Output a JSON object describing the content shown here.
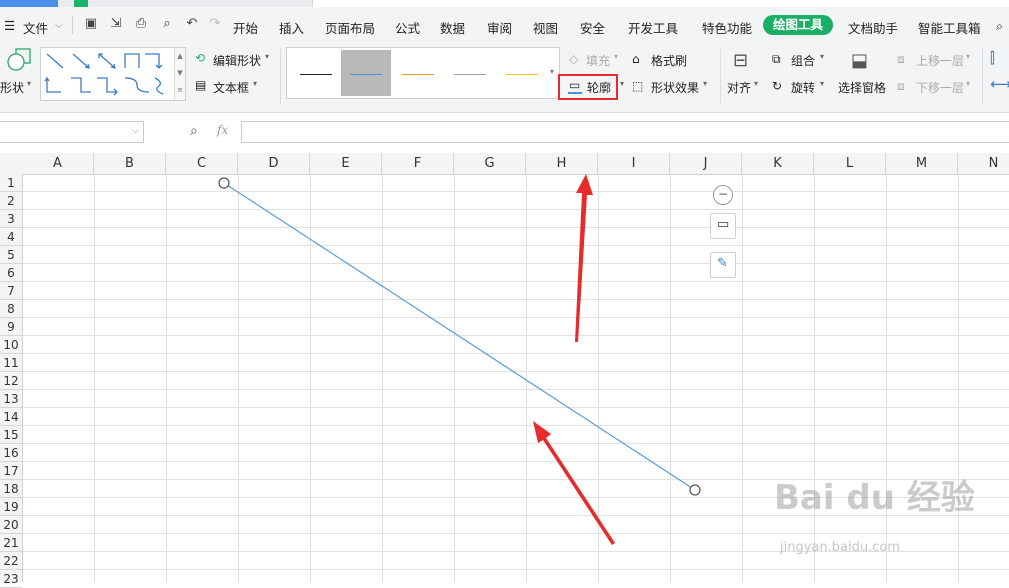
{
  "menu": {
    "file_label": "文件",
    "tabs": [
      "开始",
      "插入",
      "页面布局",
      "公式",
      "数据",
      "审阅",
      "视图",
      "安全",
      "开发工具",
      "特色功能",
      "绘图工具",
      "文档助手",
      "智能工具箱"
    ]
  },
  "ribbon": {
    "shape_label": "形状",
    "edit_shape": "编辑形状",
    "text_box": "文本框",
    "fill": "填充",
    "format_painter": "格式刷",
    "outline": "轮廓",
    "shape_effects": "形状效果",
    "align": "对齐",
    "group": "组合",
    "rotate": "旋转",
    "selection_pane": "选择窗格",
    "bring_forward": "上移一层",
    "send_backward": "下移一层",
    "style_swatches": [
      {
        "color": "#222222"
      },
      {
        "color": "#4a8fd8"
      },
      {
        "color": "#e0a030"
      },
      {
        "color": "#9aa0a8"
      },
      {
        "color": "#f0c020"
      }
    ]
  },
  "formula_bar": {
    "fx_label": "fx",
    "name_box_value": "",
    "formula_value": ""
  },
  "sheet": {
    "columns": [
      "A",
      "B",
      "C",
      "D",
      "E",
      "F",
      "G",
      "H",
      "I",
      "J",
      "K",
      "L",
      "M",
      "N"
    ],
    "rows": [
      "1",
      "2",
      "3",
      "4",
      "5",
      "6",
      "7",
      "8",
      "9",
      "10",
      "11",
      "12",
      "13",
      "14",
      "15",
      "16",
      "17",
      "18",
      "19",
      "20",
      "21",
      "22",
      "23"
    ]
  },
  "colors": {
    "accent_green": "#1aaf66",
    "line_color": "#5b9bd5",
    "annotation_red": "#e52b2b"
  },
  "watermark": {
    "brand": "Bai du 经验",
    "url": "jingyan.baidu.com"
  }
}
